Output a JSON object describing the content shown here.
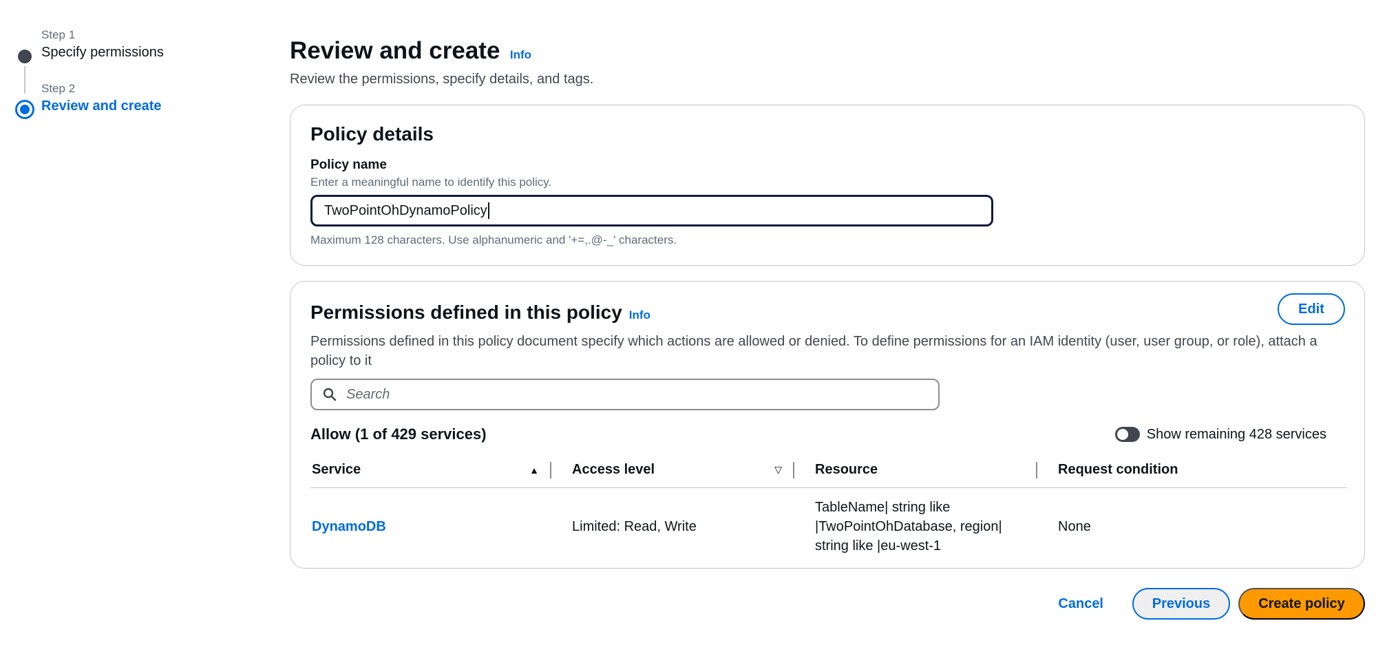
{
  "stepper": {
    "steps": [
      {
        "label": "Step 1",
        "title": "Specify permissions"
      },
      {
        "label": "Step 2",
        "title": "Review and create"
      }
    ]
  },
  "header": {
    "title": "Review and create",
    "info": "Info",
    "description": "Review the permissions, specify details, and tags."
  },
  "policy_details": {
    "title": "Policy details",
    "name_label": "Policy name",
    "name_description": "Enter a meaningful name to identify this policy.",
    "name_value": "TwoPointOhDynamoPolicy",
    "name_constraint": "Maximum 128 characters. Use alphanumeric and '+=,.@-_' characters."
  },
  "permissions": {
    "title": "Permissions defined in this policy",
    "info": "Info",
    "edit_label": "Edit",
    "description": "Permissions defined in this policy document specify which actions are allowed or denied. To define permissions for an IAM identity (user, user group, or role), attach a policy to it",
    "search_placeholder": "Search",
    "allow_title": "Allow (1 of 429 services)",
    "toggle_label": "Show remaining 428 services",
    "columns": [
      "Service",
      "Access level",
      "Resource",
      "Request condition"
    ],
    "rows": [
      {
        "service": "DynamoDB",
        "access_level": "Limited: Read, Write",
        "resource": "TableName| string like |TwoPointOhDatabase, region| string like |eu-west-1",
        "request_condition": "None"
      }
    ]
  },
  "footer": {
    "cancel": "Cancel",
    "previous": "Previous",
    "create": "Create policy"
  },
  "colors": {
    "link": "#006ce0",
    "primary_button": "#ff9900"
  }
}
